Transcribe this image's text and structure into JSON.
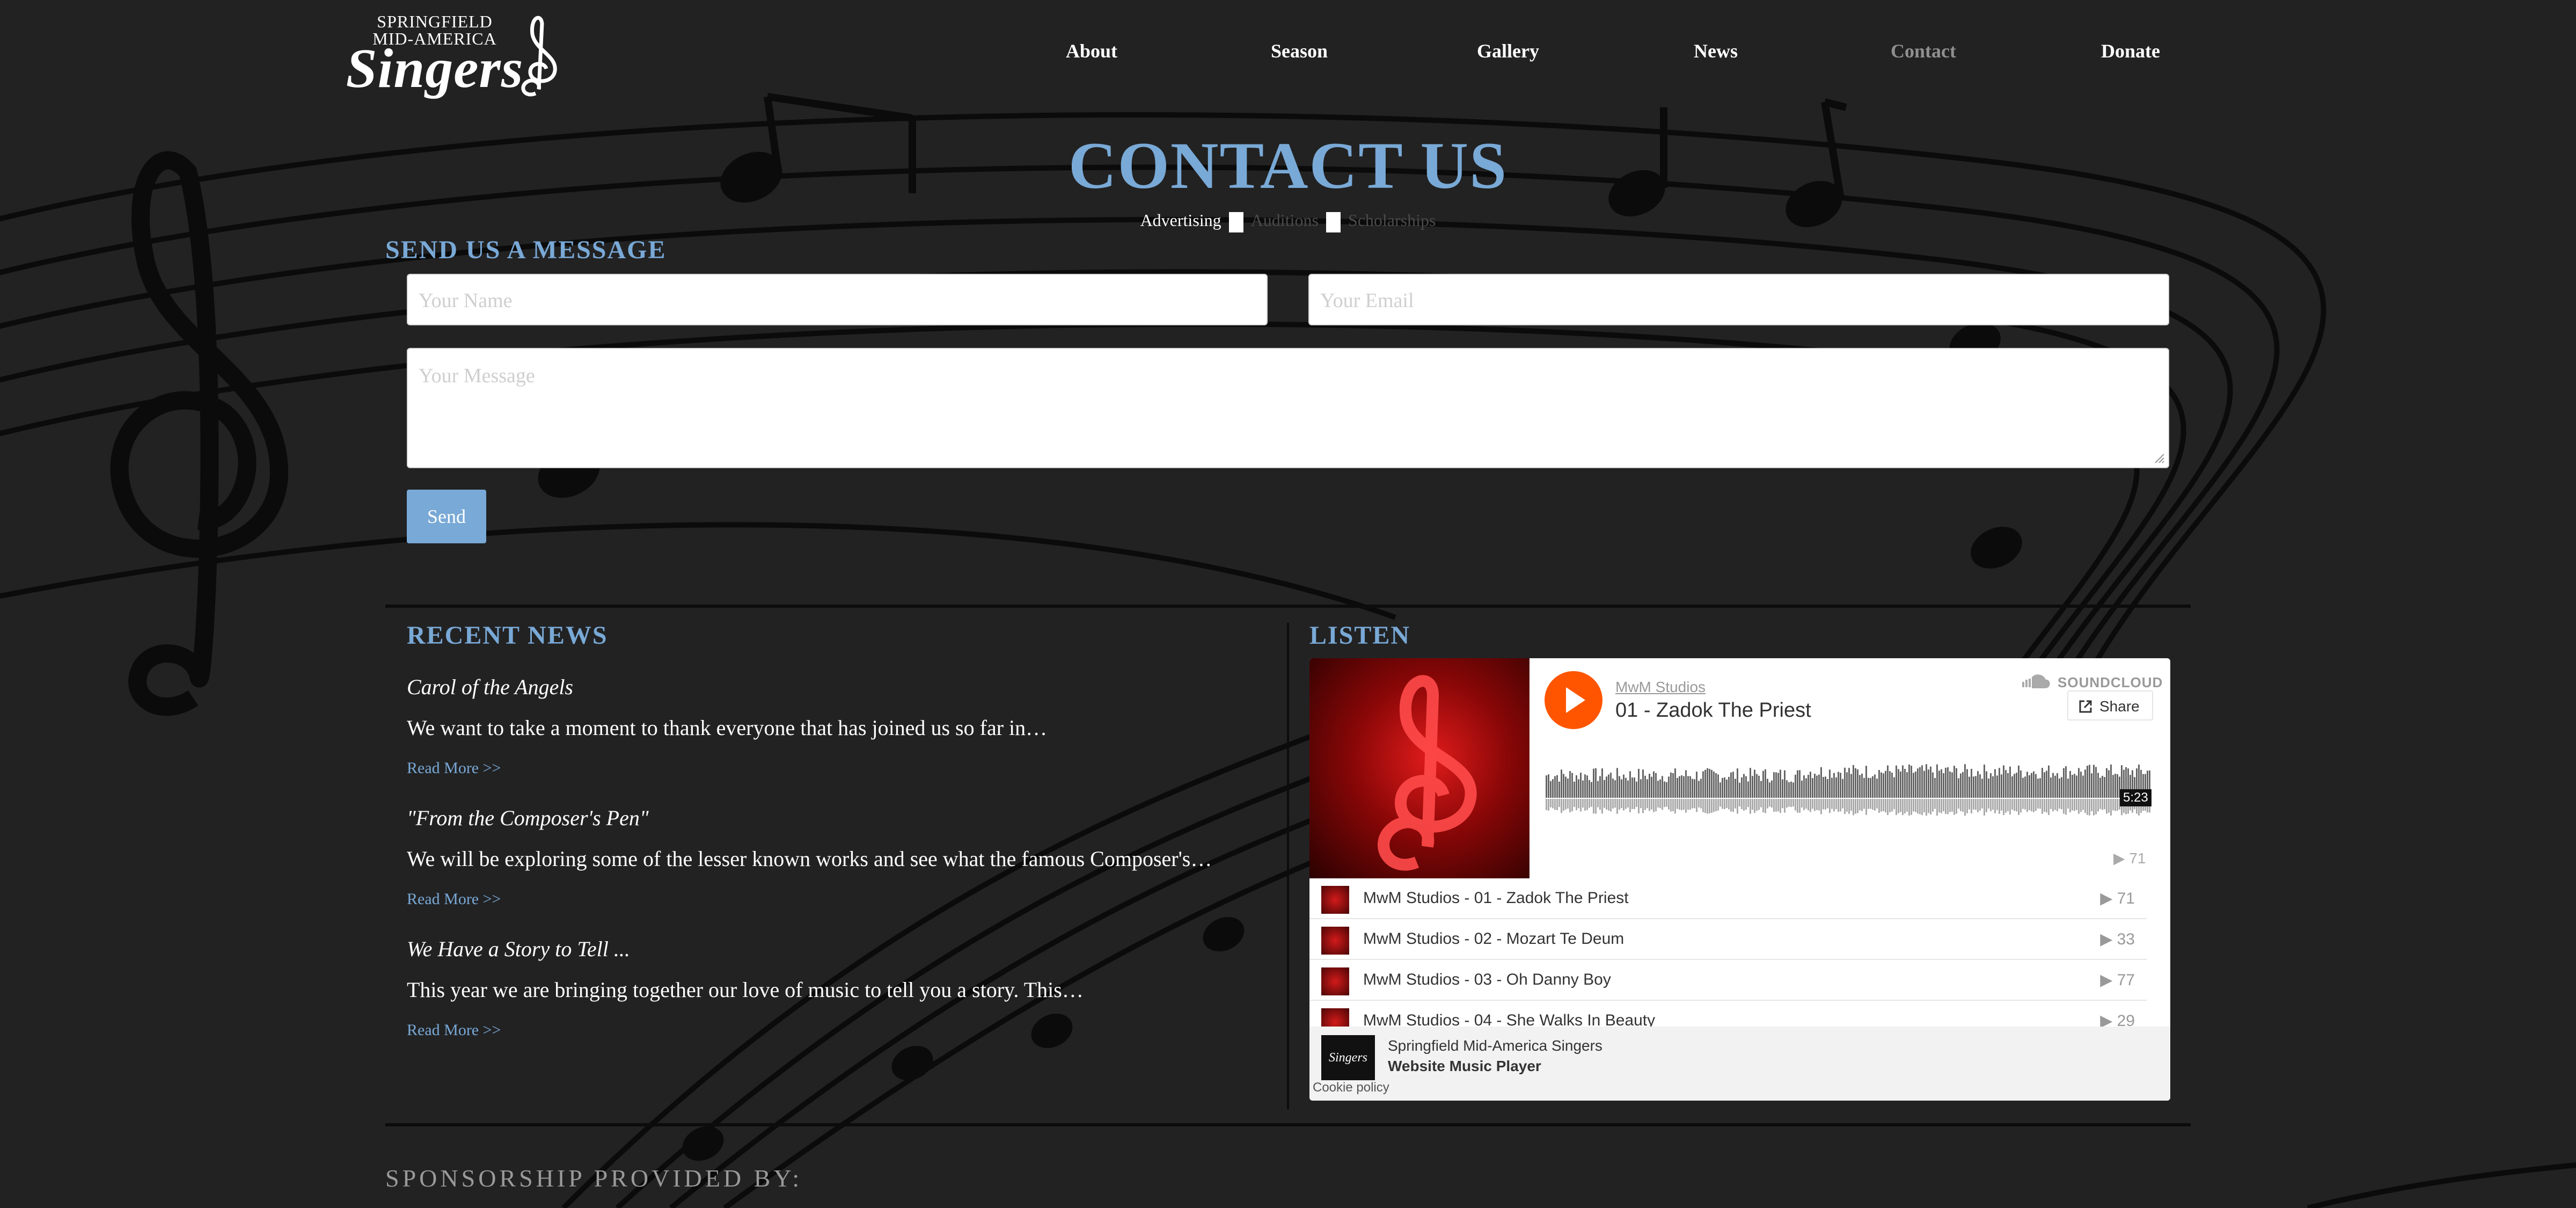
{
  "logo": {
    "line1": "SPRINGFIELD",
    "line2": "MID-AMERICA",
    "line3": "Singers"
  },
  "nav": {
    "items": [
      "About",
      "Season",
      "Gallery",
      "News",
      "Contact",
      "Donate"
    ],
    "active": "Contact"
  },
  "page_title": "CONTACT US",
  "subnav": {
    "items": [
      "Advertising",
      "Auditions",
      "Scholarships"
    ]
  },
  "form": {
    "heading": "SEND US A MESSAGE",
    "name_placeholder": "Your Name",
    "email_placeholder": "Your Email",
    "message_placeholder": "Your Message",
    "send_label": "Send"
  },
  "news": {
    "heading": "RECENT NEWS",
    "items": [
      {
        "title": "Carol of the Angels",
        "excerpt": "We want to take a moment to thank everyone that has joined us so far in…",
        "more": "Read More >>"
      },
      {
        "title": "\"From the Composer's Pen\"",
        "excerpt": "We will be exploring some of the lesser known works and see what the famous Composer's…",
        "more": "Read More >>"
      },
      {
        "title": "We Have a Story to Tell ...",
        "excerpt": "This year we are bringing together our love of music to tell you a story. This…",
        "more": "Read More >>"
      }
    ]
  },
  "listen": {
    "heading": "LISTEN",
    "player": {
      "artist": "MwM Studios",
      "track": "01 - Zadok The Priest",
      "brand": "SOUNDCLOUD",
      "share_label": "Share",
      "duration": "5:23",
      "plays": "71",
      "tracks": [
        {
          "name": "MwM Studios - 01 - Zadok The Priest",
          "plays": "71"
        },
        {
          "name": "MwM Studios - 02 - Mozart Te Deum",
          "plays": "33"
        },
        {
          "name": "MwM Studios - 03 - Oh Danny Boy",
          "plays": "77"
        },
        {
          "name": "MwM Studios - 04 - She Walks In Beauty",
          "plays": "29"
        }
      ],
      "footer_title": "Springfield Mid-America Singers",
      "footer_subtitle": "Website Music Player",
      "cookie_policy": "Cookie policy"
    }
  },
  "sponsorship": "SPONSORSHIP PROVIDED BY:",
  "colors": {
    "background": "#222223",
    "accent": "#79a9d6",
    "soundcloud_orange": "#ff5500"
  }
}
